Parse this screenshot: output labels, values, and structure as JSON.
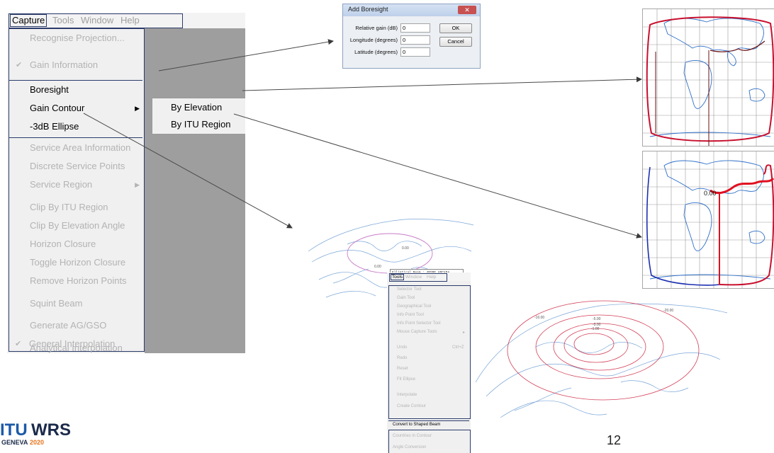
{
  "capture_menu": {
    "menubar": [
      "Capture",
      "Tools",
      "Window",
      "Help"
    ],
    "items": [
      {
        "label": "Recognise Projection...",
        "enabled": false
      },
      {
        "label": "Gain Information",
        "enabled": false,
        "checked": true
      },
      {
        "label": "Boresight",
        "enabled": true
      },
      {
        "label": "Gain Contour",
        "enabled": true,
        "submenu": true
      },
      {
        "label": "-3dB Ellipse",
        "enabled": true
      },
      {
        "label": "Service Area Information",
        "enabled": false
      },
      {
        "label": "Discrete Service Points",
        "enabled": false
      },
      {
        "label": "Service Region",
        "enabled": false,
        "submenu": true
      },
      {
        "label": "Clip By ITU Region",
        "enabled": false
      },
      {
        "label": "Clip By Elevation Angle",
        "enabled": false
      },
      {
        "label": "Horizon Closure",
        "enabled": false
      },
      {
        "label": "Toggle Horizon Closure",
        "enabled": false
      },
      {
        "label": "Remove Horizon Points",
        "enabled": false
      },
      {
        "label": "Squint Beam",
        "enabled": false
      },
      {
        "label": "Generate AG/GSO",
        "enabled": false
      },
      {
        "label": "Analytical Interpolation",
        "enabled": false
      },
      {
        "label": "General Interpolation",
        "enabled": false,
        "checked": true
      }
    ],
    "submenu": [
      "By Elevation",
      "By ITU Region"
    ]
  },
  "dialog": {
    "title": "Add Boresight",
    "fields": [
      {
        "label": "Relative gain (dB)",
        "value": "0"
      },
      {
        "label": "Longitude (degrees)",
        "value": "0"
      },
      {
        "label": "Latitude (degrees)",
        "value": "0"
      }
    ],
    "ok": "OK",
    "cancel": "Cancel"
  },
  "maps": {
    "contour_label_1": "0.00",
    "contour_label_2": "0.00",
    "ellipse_label": "0.00",
    "ellipse_note": "Elliptical Beam : 4PSBE ARCADA",
    "shaped_labels": [
      "-10.00",
      "-5.00",
      "-3.00",
      "-20.00",
      "-1.00"
    ]
  },
  "tools_menu": {
    "menubar": [
      "Tools",
      "Window",
      "Help"
    ],
    "items": [
      {
        "label": "Selector Tool",
        "enabled": false
      },
      {
        "label": "Gain Tool",
        "enabled": false
      },
      {
        "label": "Geographical Tool",
        "enabled": false
      },
      {
        "label": "Info Point Tool",
        "enabled": false
      },
      {
        "label": "Info Point Selector Tool",
        "enabled": false
      },
      {
        "label": "Mouse Capture Tools",
        "enabled": false
      },
      {
        "label": "Undo",
        "enabled": false,
        "shortcut": "Ctrl+Z"
      },
      {
        "label": "Redo",
        "enabled": false
      },
      {
        "label": "Reset",
        "enabled": false
      },
      {
        "label": "Fit Ellipse",
        "enabled": false
      },
      {
        "label": "Interpolate",
        "enabled": false
      },
      {
        "label": "Create Contour",
        "enabled": false
      },
      {
        "label": "Convert to Shaped Beam",
        "enabled": true
      },
      {
        "label": "Countries in Contour",
        "enabled": false
      },
      {
        "label": "Angle Conversion",
        "enabled": false
      }
    ]
  },
  "logo": {
    "brand_itu": "ITU",
    "brand_wrs": "WRS",
    "city": "GENEVA",
    "year": "2020"
  },
  "page_number": "12",
  "colors": {
    "menu_outline": "#2b3b6b",
    "contour_red": "#c8102e",
    "map_blue": "#2e6fc9",
    "logo_blue": "#1d5aa8",
    "logo_orange": "#e8731c"
  }
}
